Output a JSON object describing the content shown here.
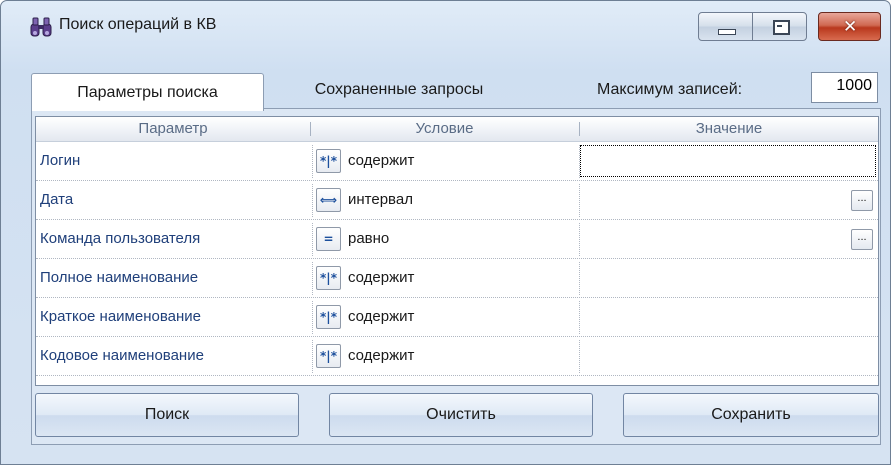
{
  "window": {
    "title": "Поиск операций в КВ",
    "title_icon": "binoculars-icon",
    "controls": [
      "minimize-icon",
      "maximize-icon",
      "close-icon"
    ],
    "close_glyph": "✕"
  },
  "tabs": [
    {
      "label": "Параметры поиска",
      "active": true
    },
    {
      "label": "Сохраненные запросы",
      "active": false
    }
  ],
  "max_records": {
    "label": "Максимум записей:",
    "value": "1000"
  },
  "grid": {
    "columns": [
      "Параметр",
      "Условие",
      "Значение"
    ],
    "rows": [
      {
        "param": "Логин",
        "icon": "contains-icon",
        "icon_glyph": "*|*",
        "condition": "содержит",
        "value": "",
        "has_button": false
      },
      {
        "param": "Дата",
        "icon": "interval-icon",
        "icon_glyph": "⟺",
        "condition": "интервал",
        "value": "",
        "has_button": true
      },
      {
        "param": "Команда пользователя",
        "icon": "equals-icon",
        "icon_glyph": "=",
        "condition": "равно",
        "value": "",
        "has_button": true
      },
      {
        "param": "Полное наименование",
        "icon": "contains-icon",
        "icon_glyph": "*|*",
        "condition": "содержит",
        "value": "",
        "has_button": false
      },
      {
        "param": "Краткое наименование",
        "icon": "contains-icon",
        "icon_glyph": "*|*",
        "condition": "содержит",
        "value": "",
        "has_button": false
      },
      {
        "param": "Кодовое наименование",
        "icon": "contains-icon",
        "icon_glyph": "*|*",
        "condition": "содержит",
        "value": "",
        "has_button": false
      }
    ],
    "ellipsis": "..."
  },
  "buttons": {
    "search": "Поиск",
    "clear": "Очистить",
    "save": "Сохранить"
  }
}
